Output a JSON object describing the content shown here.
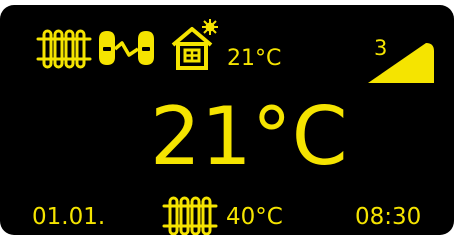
{
  "colors": {
    "accent": "#f5e400",
    "background": "#000000"
  },
  "status_bar": {
    "radiator_icon": "radiator-icon",
    "valve_link_icon": "valve-link-icon",
    "home_sun_icon": "house-sun-icon",
    "outdoor_temperature": "21°C",
    "signal_level": "3",
    "signal_icon": "signal-strength-triangle-icon"
  },
  "main": {
    "room_temperature": "21°C"
  },
  "footer": {
    "date": "01.01.",
    "radiator_icon": "radiator-icon",
    "flow_temperature": "40°C",
    "time": "08:30"
  }
}
